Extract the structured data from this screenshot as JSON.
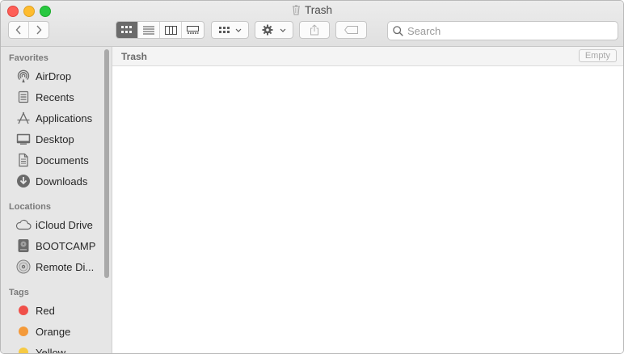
{
  "window": {
    "title": "Trash"
  },
  "toolbar": {
    "search_placeholder": "Search",
    "view_modes": [
      "icons-view",
      "list-view",
      "columns-view",
      "gallery-view"
    ],
    "active_view": "icons-view"
  },
  "sidebar": {
    "favorites_title": "Favorites",
    "favorites": [
      {
        "label": "AirDrop",
        "icon": "airdrop-icon"
      },
      {
        "label": "Recents",
        "icon": "recents-icon"
      },
      {
        "label": "Applications",
        "icon": "applications-icon"
      },
      {
        "label": "Desktop",
        "icon": "desktop-icon"
      },
      {
        "label": "Documents",
        "icon": "documents-icon"
      },
      {
        "label": "Downloads",
        "icon": "downloads-icon"
      }
    ],
    "locations_title": "Locations",
    "locations": [
      {
        "label": "iCloud Drive",
        "icon": "cloud-icon"
      },
      {
        "label": "BOOTCAMP",
        "icon": "disk-icon"
      },
      {
        "label": "Remote Di...",
        "icon": "disc-icon"
      }
    ],
    "tags_title": "Tags",
    "tags": [
      {
        "label": "Red",
        "color": "#f0504a"
      },
      {
        "label": "Orange",
        "color": "#f49a3a"
      },
      {
        "label": "Yellow",
        "color": "#f6ca44"
      }
    ]
  },
  "main": {
    "path_title": "Trash",
    "empty_button": "Empty"
  }
}
